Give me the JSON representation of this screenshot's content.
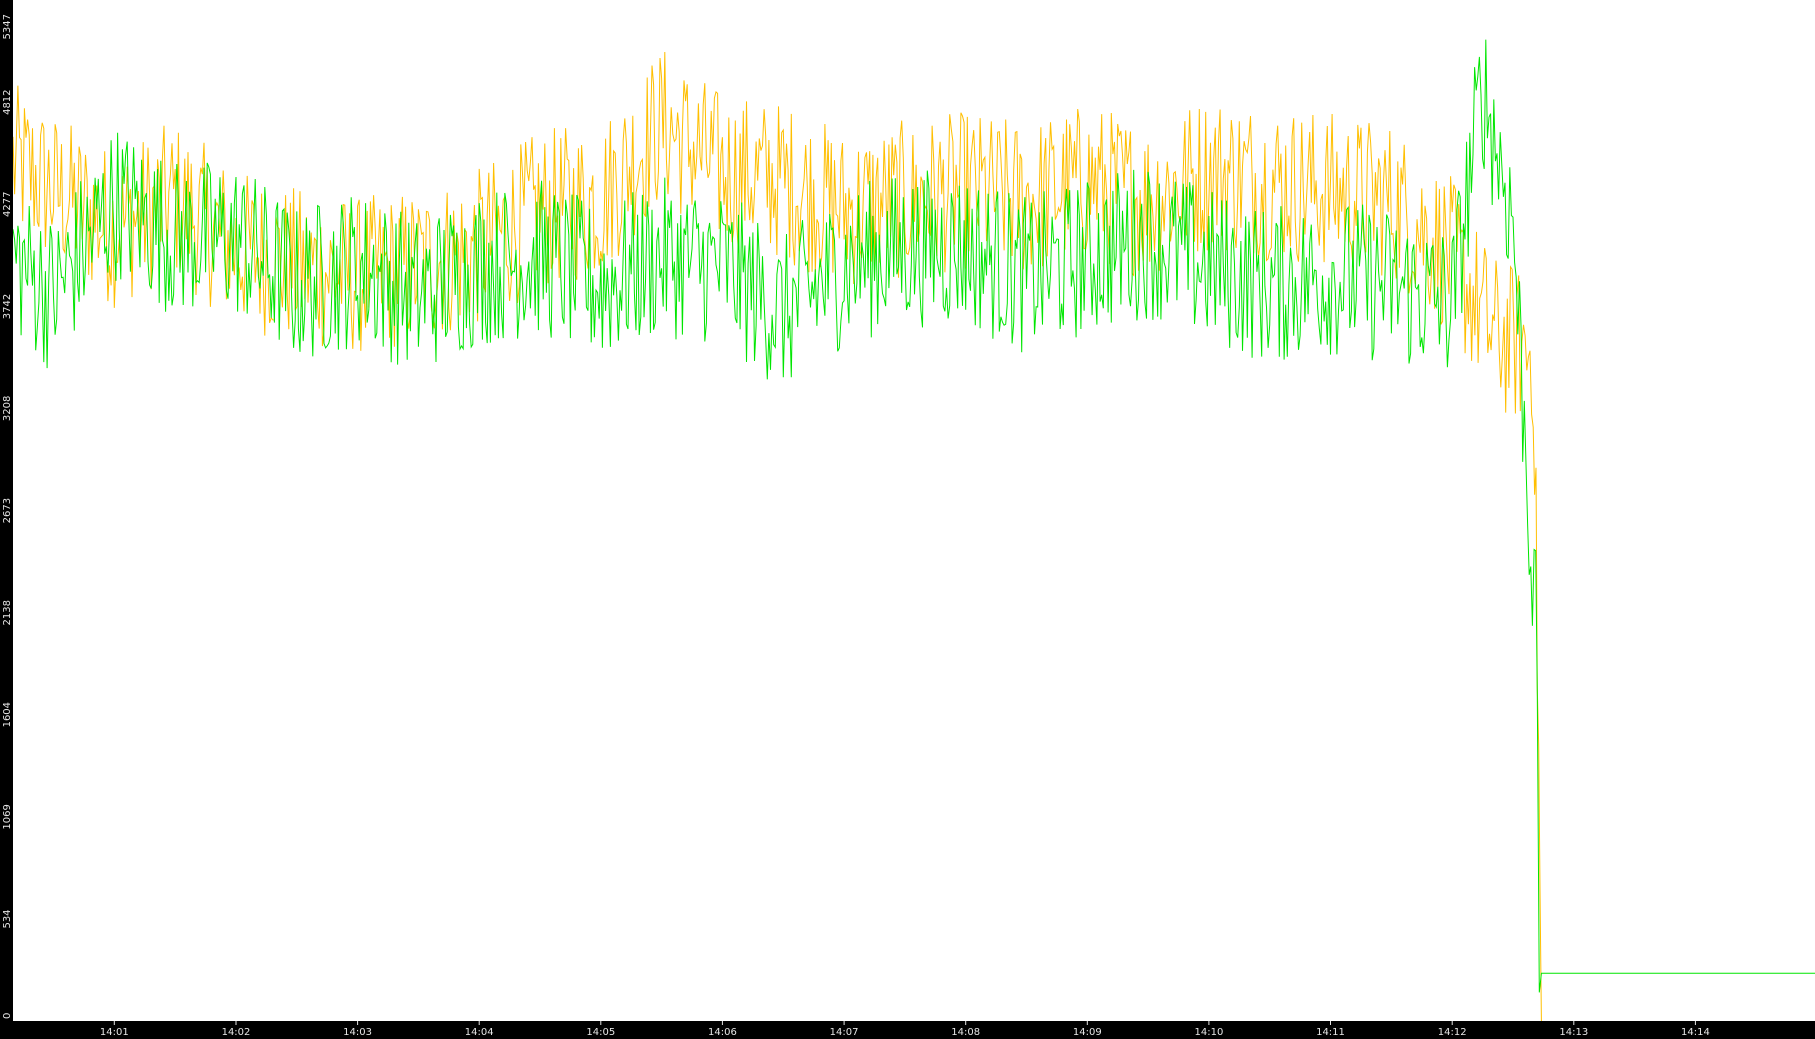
{
  "chart_data": {
    "type": "line",
    "title": "",
    "xlabel": "",
    "ylabel": "",
    "grid": false,
    "legend": "none",
    "colors": {
      "background": "#ffffff",
      "axis_band": "#000000",
      "tick_text": "#e6e6e6",
      "series_orange": "#ffbf00",
      "series_green": "#00e600"
    },
    "ylim": [
      0,
      5347
    ],
    "y_tick_labels": [
      "0",
      "534",
      "1069",
      "1604",
      "2138",
      "2673",
      "3208",
      "3742",
      "4277",
      "4812",
      "5347"
    ],
    "x_range": [
      "14:00:10",
      "14:14:59"
    ],
    "x_tick_labels": [
      "14:01",
      "14:02",
      "14:03",
      "14:04",
      "14:05",
      "14:06",
      "14:07",
      "14:08",
      "14:09",
      "14:10",
      "14:11",
      "14:12",
      "14:13",
      "14:14"
    ],
    "series": [
      {
        "color": "#ffbf00",
        "x": [
          "14:00:10",
          "14:00:30",
          "14:01:00",
          "14:01:30",
          "14:02:00",
          "14:02:30",
          "14:03:00",
          "14:03:30",
          "14:04:00",
          "14:04:30",
          "14:05:00",
          "14:05:30",
          "14:06:00",
          "14:06:30",
          "14:07:00",
          "14:07:30",
          "14:08:00",
          "14:08:30",
          "14:09:00",
          "14:09:30",
          "14:10:00",
          "14:10:30",
          "14:11:00",
          "14:11:30",
          "14:12:00",
          "14:12:20",
          "14:12:40",
          "14:12:42",
          "14:12:44"
        ],
        "values": [
          4500,
          4350,
          4150,
          4300,
          4050,
          3950,
          3900,
          3950,
          4050,
          4250,
          4300,
          4700,
          4450,
          4400,
          4250,
          4300,
          4350,
          4300,
          4400,
          4300,
          4450,
          4400,
          4350,
          4300,
          4000,
          3600,
          3500,
          2000,
          0
        ]
      },
      {
        "color": "#00e600",
        "x": [
          "14:00:10",
          "14:00:30",
          "14:01:00",
          "14:01:30",
          "14:02:00",
          "14:02:30",
          "14:03:00",
          "14:03:30",
          "14:04:00",
          "14:04:30",
          "14:05:00",
          "14:05:30",
          "14:06:00",
          "14:06:30",
          "14:07:00",
          "14:07:30",
          "14:08:00",
          "14:08:30",
          "14:09:00",
          "14:09:30",
          "14:10:00",
          "14:10:30",
          "14:11:00",
          "14:11:30",
          "14:12:00",
          "14:12:15",
          "14:12:30",
          "14:12:42",
          "14:12:43",
          "14:12:44",
          "14:14:59"
        ],
        "values": [
          4000,
          3800,
          4300,
          4100,
          4100,
          3850,
          3950,
          3800,
          3950,
          4000,
          3850,
          4000,
          3950,
          3700,
          3950,
          4050,
          4050,
          3900,
          4000,
          4100,
          3950,
          3850,
          3900,
          3850,
          3750,
          4900,
          4200,
          1900,
          150,
          250,
          250
        ]
      }
    ]
  }
}
